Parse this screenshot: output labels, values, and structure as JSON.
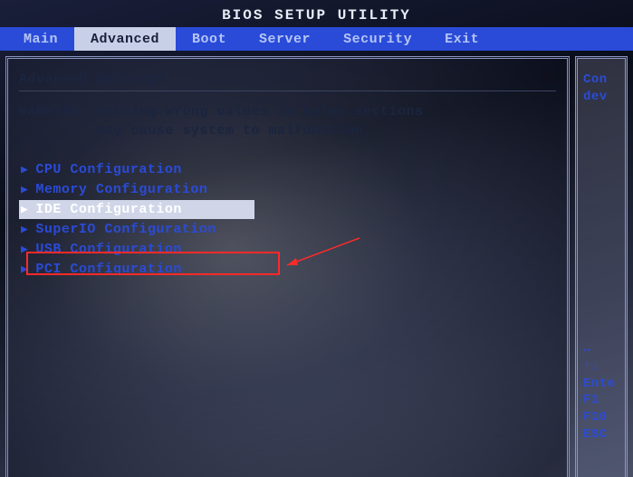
{
  "title": "BIOS SETUP UTILITY",
  "tabs": {
    "items": [
      {
        "label": "Main"
      },
      {
        "label": "Advanced"
      },
      {
        "label": "Boot"
      },
      {
        "label": "Server"
      },
      {
        "label": "Security"
      },
      {
        "label": "Exit"
      }
    ],
    "active_index": 1
  },
  "panel": {
    "heading": "Advanced Settings",
    "warning": "WARNING: Setting wrong values in below sections\n         may cause system to malfunction.",
    "menu": [
      {
        "label": "CPU Configuration"
      },
      {
        "label": "Memory Configuration"
      },
      {
        "label": "IDE Configuration"
      },
      {
        "label": "SuperIO Configuration"
      },
      {
        "label": "USB Configuration"
      },
      {
        "label": "PCI Configuration"
      }
    ],
    "selected_index": 2
  },
  "side": {
    "hint_top": "Con\ndev",
    "hint_bottom": "↔\n↑↓\nEnte\nF1\nF10\nESC"
  },
  "annotation": "red-callout-arrow"
}
